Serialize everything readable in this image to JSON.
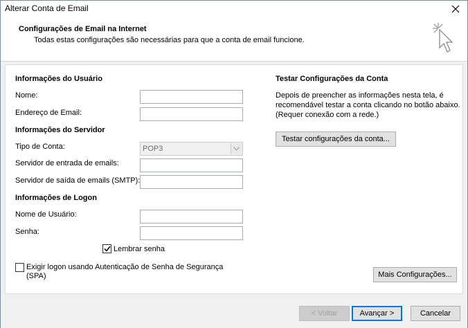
{
  "window": {
    "title": "Alterar Conta de Email"
  },
  "header": {
    "title": "Configurações de Email na Internet",
    "subtitle": "Todas estas configurações são necessárias para que a conta de email funcione."
  },
  "user_info": {
    "section_title": "Informações do Usuário",
    "name_label": "Nome:",
    "name_value": "",
    "email_label": "Endereço de Email:",
    "email_value": ""
  },
  "server_info": {
    "section_title": "Informações do Servidor",
    "account_type_label": "Tipo de Conta:",
    "account_type_value": "POP3",
    "incoming_label": "Servidor de entrada de emails:",
    "incoming_value": "",
    "outgoing_label": "Servidor de saída de emails (SMTP):",
    "outgoing_value": ""
  },
  "logon_info": {
    "section_title": "Informações de Logon",
    "username_label": "Nome de Usuário:",
    "username_value": "",
    "password_label": "Senha:",
    "password_value": "",
    "remember_label": "Lembrar senha",
    "remember_checked": true,
    "spa_label_line1": "Exigir logon usando Autenticação de Senha de Segurança",
    "spa_label_line2": "(SPA)",
    "spa_checked": false
  },
  "test": {
    "section_title": "Testar Configurações da Conta",
    "desc_line1": "Depois de preencher as informações nesta tela, é",
    "desc_line2": "recomendável testar a conta clicando no botão abaixo.",
    "desc_line3": "(Requer conexão com a rede.)",
    "test_button": "Testar configurações da conta..."
  },
  "more_settings_button": "Mais Configurações...",
  "footer": {
    "back_button": "< Voltar",
    "next_button": "Avançar >",
    "cancel_button": "Cancelar"
  },
  "colors": {
    "accent": "#0078d7",
    "panel_bg": "#ffffff",
    "window_bg": "#f0f0f0"
  },
  "icons": {
    "close": "close-icon",
    "wizard": "cursor-sparkle-icon",
    "dropdown": "chevron-down-icon",
    "check": "checkmark-icon"
  }
}
